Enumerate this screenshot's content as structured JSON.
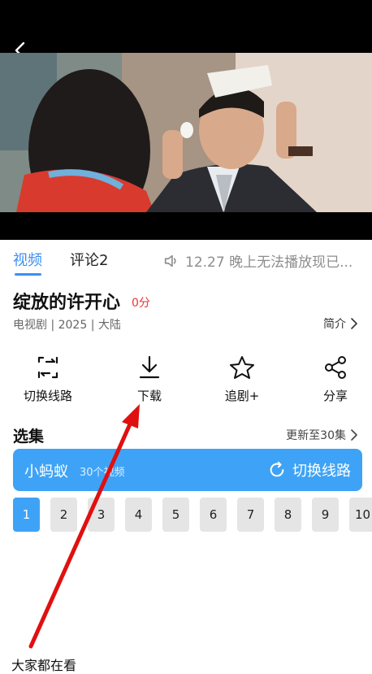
{
  "colors": {
    "accent": "#3b8ff2",
    "source_bar": "#3ea3f6",
    "score": "#e33333",
    "annotation_arrow": "#e01010"
  },
  "player": {
    "back_icon": "chevron-left-icon"
  },
  "tabs": [
    {
      "label": "视频"
    },
    {
      "label": "评论2"
    }
  ],
  "notice": {
    "icon": "speaker-icon",
    "text": "12.27 晚上无法播放现已..."
  },
  "show": {
    "title": "绽放的许开心",
    "score": "0分",
    "meta": "电视剧 | 2025 | 大陆",
    "intro_label": "简介"
  },
  "actions": [
    {
      "label": "切换线路",
      "icon": "switch-route-icon"
    },
    {
      "label": "下载",
      "icon": "download-icon"
    },
    {
      "label": "追剧+",
      "icon": "star-icon"
    },
    {
      "label": "分享",
      "icon": "share-icon"
    }
  ],
  "episodes_section": {
    "title": "选集",
    "update_text": "更新至30集",
    "source_name": "小蚂蚁",
    "source_count": "30个视频",
    "switch_label": "切换线路",
    "items": [
      "1",
      "2",
      "3",
      "4",
      "5",
      "6",
      "7",
      "8",
      "9",
      "10"
    ],
    "selected": "1"
  },
  "bottom": {
    "text": "大家都在看"
  }
}
